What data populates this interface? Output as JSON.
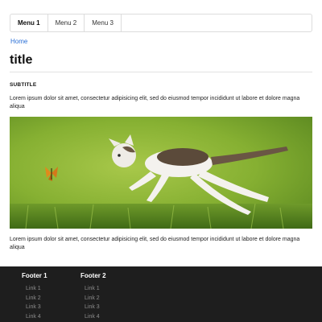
{
  "nav": {
    "items": [
      {
        "label": "Menu 1"
      },
      {
        "label": "Menu 2"
      },
      {
        "label": "Menu 3"
      }
    ]
  },
  "breadcrumb": {
    "home": "Home"
  },
  "page": {
    "title": "title",
    "subtitle": "SUBTITLE",
    "paragraph1": "Lorem ipsum dolor sit amet, consectetur adipisicing elit, sed do eiusmod tempor incididunt ut labore et dolore magna aliqua",
    "paragraph2": "Lorem ipsum dolor sit amet, consectetur adipisicing elit, sed do eiusmod tempor incididunt ut labore et dolore magna aliqua"
  },
  "hero": {
    "icon": "kitten-butterfly-photo",
    "colors": {
      "background": "#86b032",
      "grass": "#4f7d1e"
    }
  },
  "footer": {
    "columns": [
      {
        "heading": "Footer 1",
        "links": [
          "Link 1",
          "Link 2",
          "Link 3",
          "Link 4"
        ]
      },
      {
        "heading": "Footer 2",
        "links": [
          "Link 1",
          "Link 2",
          "Link 3",
          "Link 4"
        ]
      }
    ]
  },
  "colors": {
    "link": "#2a6fd6",
    "footer_bg": "#1e1e1e",
    "footer_link": "#8c8c8c"
  }
}
